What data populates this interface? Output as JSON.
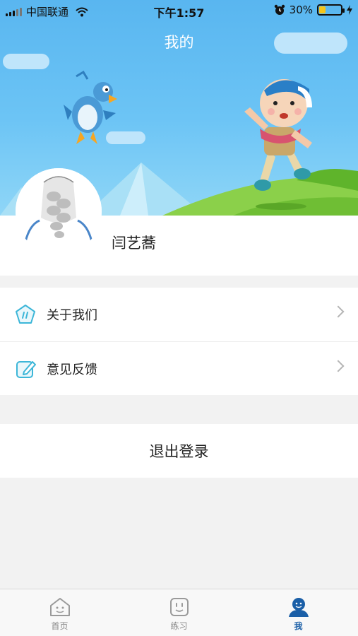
{
  "status_bar": {
    "carrier": "中国联通",
    "time": "下午1:57",
    "battery_percent": "30%",
    "battery_level": 0.3
  },
  "header": {
    "title": "我的"
  },
  "profile": {
    "name": "闫艺蕎"
  },
  "menu": {
    "items": [
      {
        "label": "关于我们",
        "icon": "pentagon-info-icon"
      },
      {
        "label": "意见反馈",
        "icon": "edit-feedback-icon"
      }
    ]
  },
  "logout": {
    "label": "退出登录"
  },
  "tabbar": {
    "items": [
      {
        "label": "首页",
        "icon": "home-icon",
        "active": false
      },
      {
        "label": "练习",
        "icon": "practice-icon",
        "active": false
      },
      {
        "label": "我",
        "icon": "profile-icon",
        "active": true
      }
    ]
  },
  "colors": {
    "sky": "#59b6f0",
    "grass": "#7ccc3a",
    "active_tab": "#1b5fa7",
    "icon_accent": "#3cb6d8"
  }
}
